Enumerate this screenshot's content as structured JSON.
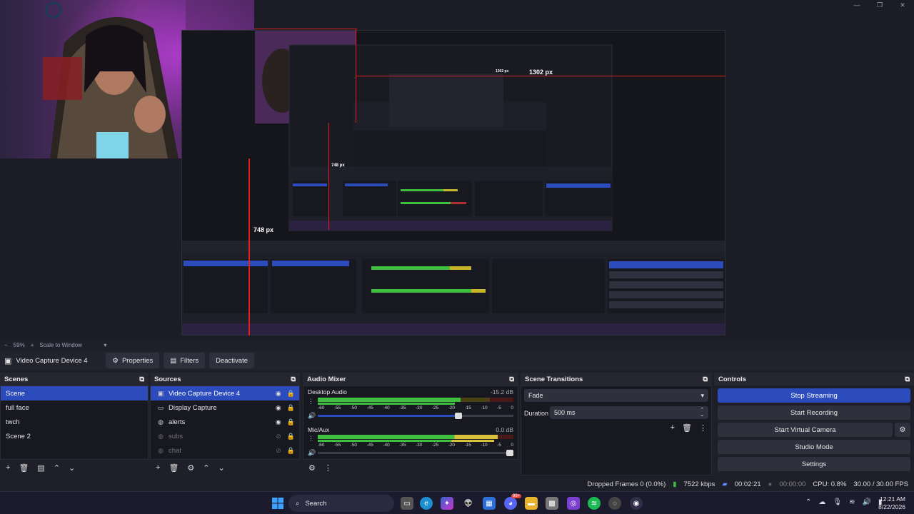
{
  "window": {
    "controls": [
      "—",
      "❐",
      "✕"
    ]
  },
  "preview": {
    "measure_width": "1302 px",
    "measure_height": "748 px",
    "measure_width_small": "1302 px",
    "measure_height_small": "748 px"
  },
  "zoom": {
    "minus": "−",
    "value": "59%",
    "plus": "+",
    "mode": "Scale to Window"
  },
  "source_toolbar": {
    "source_name": "Video Capture Device 4",
    "properties": "Properties",
    "filters": "Filters",
    "deactivate": "Deactivate"
  },
  "scenes": {
    "title": "Scenes",
    "items": [
      "Scene",
      "full face",
      "twch",
      "Scene 2"
    ]
  },
  "sources": {
    "title": "Sources",
    "items": [
      {
        "label": "Video Capture Device 4",
        "icon": "camera-icon"
      },
      {
        "label": "Display Capture",
        "icon": "monitor-icon"
      },
      {
        "label": "alerts",
        "icon": "globe-icon"
      },
      {
        "label": "subs",
        "icon": "globe-icon"
      },
      {
        "label": "chat",
        "icon": "globe-icon"
      }
    ]
  },
  "mixer": {
    "title": "Audio Mixer",
    "channels": [
      {
        "name": "Desktop Audio",
        "db": "-15.2 dB",
        "level": 0.73,
        "volume": 0.72
      },
      {
        "name": "Mic/Aux",
        "db": "0.0 dB",
        "level": 0.92,
        "volume": 1.0
      }
    ],
    "scale": [
      "-60",
      "-55",
      "-50",
      "-45",
      "-40",
      "-35",
      "-30",
      "-25",
      "-20",
      "-15",
      "-10",
      "-5",
      "0"
    ]
  },
  "transitions": {
    "title": "Scene Transitions",
    "selected": "Fade",
    "duration_label": "Duration",
    "duration_value": "500 ms"
  },
  "controls": {
    "title": "Controls",
    "stop_streaming": "Stop Streaming",
    "start_recording": "Start Recording",
    "start_virtual_camera": "Start Virtual Camera",
    "studio_mode": "Studio Mode",
    "settings": "Settings"
  },
  "status": {
    "dropped_frames": "Dropped Frames 0 (0.0%)",
    "kbps": "7522 kbps",
    "stream_time": "00:02:21",
    "rec_time": "00:00:00",
    "cpu": "CPU: 0.8%",
    "fps": "30.00 / 30.00 FPS"
  },
  "taskbar": {
    "search": "Search",
    "time": "12:21 AM",
    "date": "8/22/2026",
    "badge": "99+"
  },
  "colors": {
    "accent": "#2c4bbd",
    "meter_green": "#3fbf3f",
    "meter_yellow": "#c9b52a",
    "meter_red": "#b03030",
    "guide_red": "#e02020"
  }
}
